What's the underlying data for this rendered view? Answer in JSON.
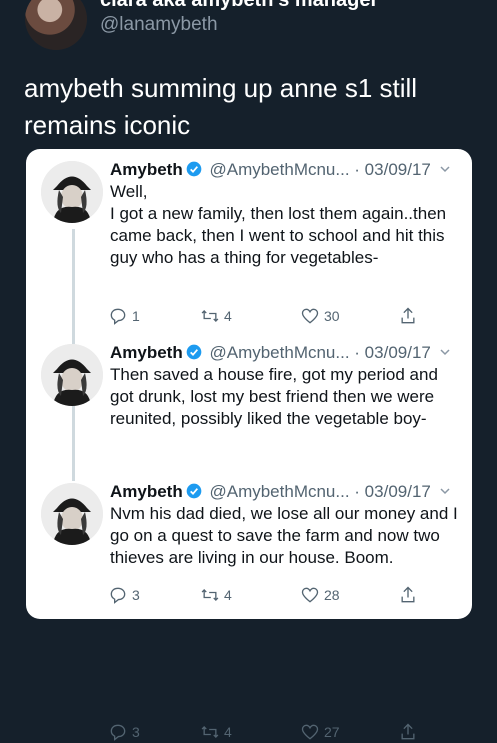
{
  "retweeter": {
    "display_name": "clara aka amybeth's manager",
    "handle": "@lanamybeth",
    "text": "amybeth summing up anne s1 still remains iconic"
  },
  "embedded": [
    {
      "name": "Amybeth",
      "handle": "@AmybethMcnu...",
      "date": "· 03/09/17",
      "text": "Well,\nI got a new family, then lost them again..then came back, then I went to school and hit this guy who has a thing for vegetables-",
      "replies": "1",
      "retweets": "4",
      "likes": "30"
    },
    {
      "name": "Amybeth",
      "handle": "@AmybethMcnu...",
      "date": "· 03/09/17",
      "text": "Then saved a house fire, got my period and got drunk, lost my best friend then we were reunited, possibly liked the vegetable boy-",
      "replies": "3",
      "retweets": "4",
      "likes": "28"
    },
    {
      "name": "Amybeth",
      "handle": "@AmybethMcnu...",
      "date": "· 03/09/17",
      "text": "Nvm his dad died, we lose all our money and I go on a quest to save the farm and now two thieves are living in our house. Boom.",
      "replies": "3",
      "retweets": "4",
      "likes": "27"
    }
  ],
  "icons": {
    "verified": "verified-badge-icon",
    "reply": "reply-icon",
    "retweet": "retweet-icon",
    "like": "heart-icon",
    "share": "share-icon",
    "menu": "chevron-down-icon"
  },
  "colors": {
    "background": "#15202b",
    "card": "#ffffff",
    "verified": "#1d9bf0",
    "muted": "#536471",
    "thread_line": "#cfd9de"
  }
}
